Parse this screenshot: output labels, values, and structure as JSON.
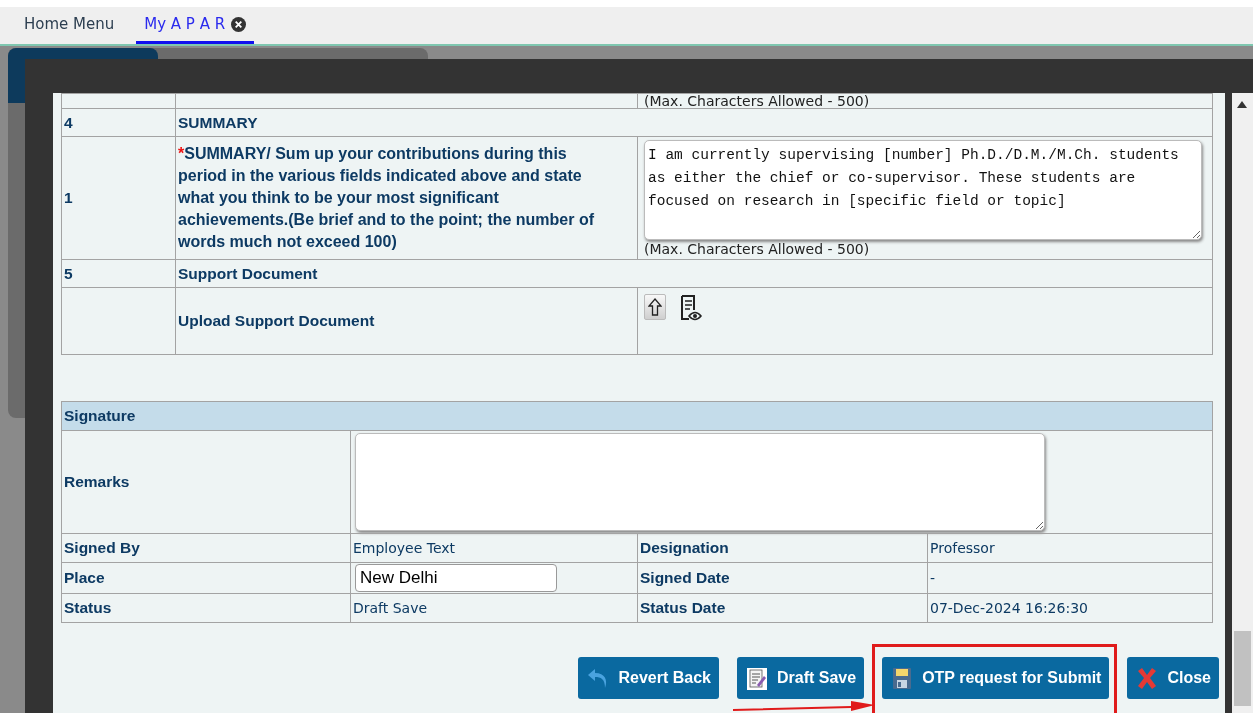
{
  "tabs": [
    {
      "label": "Home Menu",
      "selected": false,
      "closable": false
    },
    {
      "label": "My A P A R",
      "selected": true,
      "closable": true
    }
  ],
  "form": {
    "rows": [
      {
        "kind": "note",
        "note": "(Max. Characters Allowed - 500)"
      },
      {
        "kind": "section",
        "number": "4",
        "title": "SUMMARY"
      },
      {
        "kind": "textarea",
        "number": "1",
        "required_mark": "*",
        "label": "SUMMARY/ Sum up your contributions during this period in the various fields indicated above and state what you think to be your most significant achievements.(Be brief and to the point; the number of words much not exceed 100)",
        "value": "I am currently supervising [number] Ph.D./D.M./M.Ch. students as either the chief or co-supervisor. These students are focused on research in [specific field or topic]",
        "note": "(Max. Characters Allowed - 500)"
      },
      {
        "kind": "section",
        "number": "5",
        "title": "Support Document"
      },
      {
        "kind": "upload",
        "label": "Upload Support Document"
      }
    ]
  },
  "signature": {
    "title": "Signature",
    "remarks_label": "Remarks",
    "fields": [
      {
        "label": "Signed By",
        "kind": "text",
        "value": "Employee Text"
      },
      {
        "label": "Designation",
        "kind": "text",
        "value": "Professor"
      },
      {
        "label": "Place",
        "kind": "input",
        "value": "New Delhi"
      },
      {
        "label": "Signed Date",
        "kind": "text",
        "value": "-"
      },
      {
        "label": "Status",
        "kind": "text",
        "value": "Draft Save"
      },
      {
        "label": "Status Date",
        "kind": "text",
        "value": "07-Dec-2024 16:26:30"
      }
    ]
  },
  "buttons": [
    {
      "label": "Revert Back",
      "kind": "revert",
      "highlighted": false
    },
    {
      "label": "Draft Save",
      "kind": "notepad",
      "highlighted": false
    },
    {
      "label": "OTP request for Submit",
      "kind": "floppy",
      "highlighted": true
    },
    {
      "label": "Close",
      "kind": "close",
      "highlighted": false
    }
  ]
}
